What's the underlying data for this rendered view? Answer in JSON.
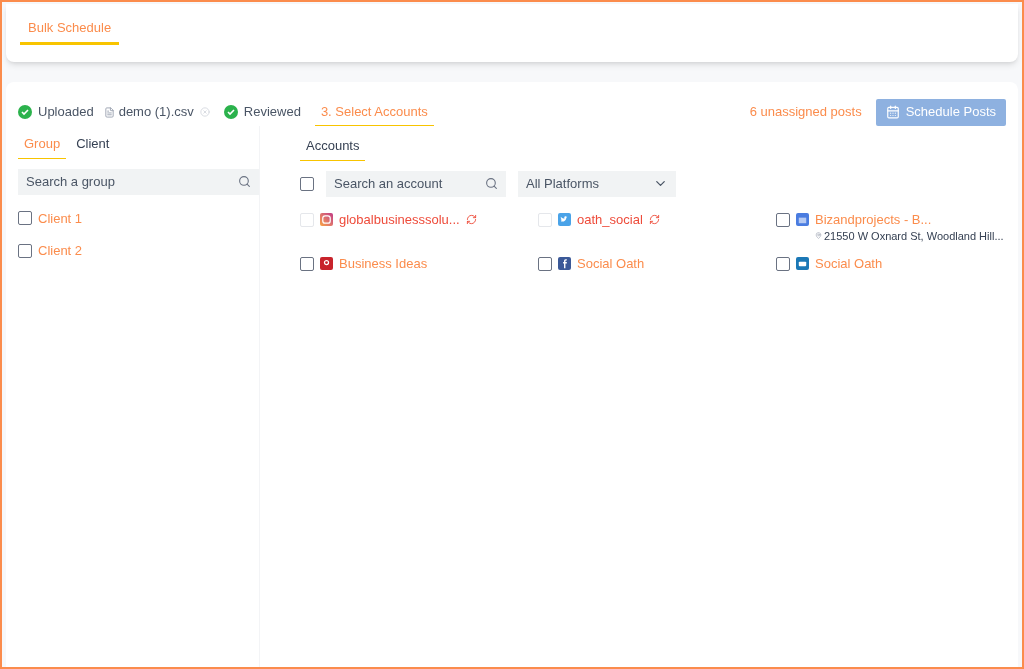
{
  "header": {
    "tab": {
      "label": "Bulk Schedule",
      "selected": true
    }
  },
  "steps": [
    {
      "label": "Uploaded",
      "done": true,
      "file": "demo (1).csv"
    },
    {
      "label": "Reviewed",
      "done": true
    },
    {
      "label": "3. Select Accounts",
      "done": false
    }
  ],
  "unassigned": "6 unassigned posts",
  "schedule_button": {
    "label": "Schedule Posts",
    "disabled": true
  },
  "left_tabs": [
    {
      "label": "Group",
      "selected": true
    },
    {
      "label": "Client",
      "selected": false
    }
  ],
  "group_search": {
    "placeholder": "Search a group"
  },
  "groups": [
    {
      "label": "Client 1",
      "checked": false
    },
    {
      "label": "Client 2",
      "checked": false
    }
  ],
  "accounts_tab": {
    "label": "Accounts",
    "selected": true
  },
  "select_all": {
    "checked": false
  },
  "account_search": {
    "placeholder": "Search an account"
  },
  "platform_filter": {
    "value": "All Platforms"
  },
  "accounts": [
    {
      "name": "globalbusinesssolu...",
      "kind": "instagram",
      "expired": true,
      "checked": false
    },
    {
      "name": "oath_social",
      "kind": "twitter",
      "expired": true,
      "checked": false
    },
    {
      "name": "Bizandprojects - B...",
      "kind": "google",
      "expired": false,
      "checked": false,
      "address": "21550 W Oxnard St, Woodland Hill..."
    },
    {
      "name": "Business Ideas",
      "kind": "pinterest",
      "expired": false,
      "checked": false
    },
    {
      "name": "Social Oath",
      "kind": "facebook",
      "expired": false,
      "checked": false
    },
    {
      "name": "Social Oath",
      "kind": "linkedin",
      "expired": false,
      "checked": false
    }
  ]
}
